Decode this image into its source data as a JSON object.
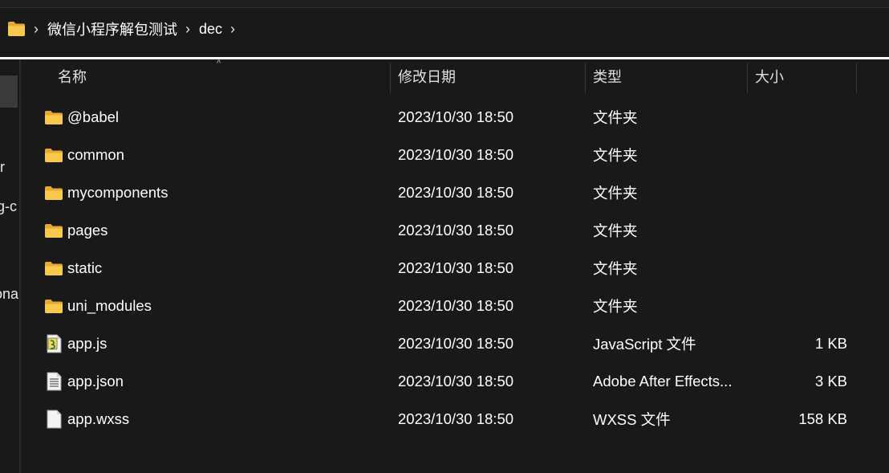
{
  "breadcrumb": {
    "items": [
      "微信小程序解包测试",
      "dec"
    ],
    "separator": "›"
  },
  "left_pane_fragments": [
    "r",
    "g-c",
    "ona"
  ],
  "columns": {
    "name": "名称",
    "date": "修改日期",
    "type": "类型",
    "size": "大小"
  },
  "files": [
    {
      "name": "@babel",
      "date": "2023/10/30 18:50",
      "type": "文件夹",
      "size": "",
      "icon": "folder-icon"
    },
    {
      "name": "common",
      "date": "2023/10/30 18:50",
      "type": "文件夹",
      "size": "",
      "icon": "folder-icon"
    },
    {
      "name": "mycomponents",
      "date": "2023/10/30 18:50",
      "type": "文件夹",
      "size": "",
      "icon": "folder-icon"
    },
    {
      "name": "pages",
      "date": "2023/10/30 18:50",
      "type": "文件夹",
      "size": "",
      "icon": "folder-icon"
    },
    {
      "name": "static",
      "date": "2023/10/30 18:50",
      "type": "文件夹",
      "size": "",
      "icon": "folder-icon"
    },
    {
      "name": "uni_modules",
      "date": "2023/10/30 18:50",
      "type": "文件夹",
      "size": "",
      "icon": "folder-icon"
    },
    {
      "name": "app.js",
      "date": "2023/10/30 18:50",
      "type": "JavaScript 文件",
      "size": "1 KB",
      "icon": "js-file-icon"
    },
    {
      "name": "app.json",
      "date": "2023/10/30 18:50",
      "type": "Adobe After Effects...",
      "size": "3 KB",
      "icon": "text-file-icon"
    },
    {
      "name": "app.wxss",
      "date": "2023/10/30 18:50",
      "type": "WXSS 文件",
      "size": "158 KB",
      "icon": "blank-file-icon"
    }
  ],
  "colors": {
    "background": "#191919",
    "folder": "#f6c244",
    "text": "#ffffff"
  }
}
